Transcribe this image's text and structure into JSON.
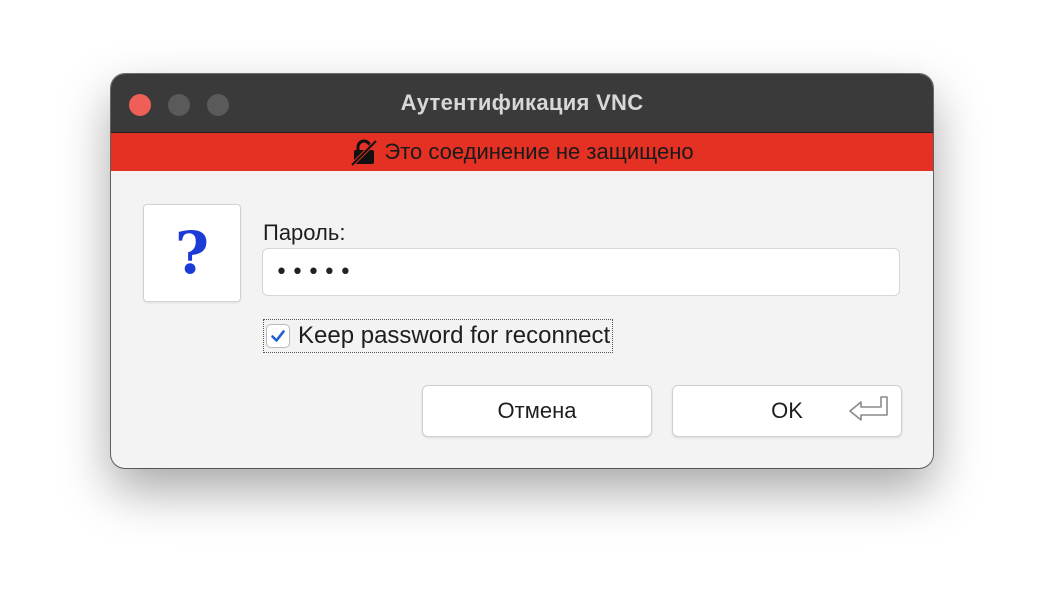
{
  "window": {
    "title": "Аутентификация VNC"
  },
  "warning": {
    "text": "Это соединение не защищено",
    "icon": "insecure-lock-icon",
    "color": "#e53123"
  },
  "dialog": {
    "icon": "question-icon",
    "password_label": "Пароль:",
    "password_value": "•••••",
    "keep_label": "Keep password for reconnect",
    "keep_checked": true
  },
  "buttons": {
    "cancel_label": "Отмена",
    "ok_label": "OK"
  },
  "colors": {
    "titlebar": "#3a3a3a",
    "accent": "#1a3bd6"
  }
}
